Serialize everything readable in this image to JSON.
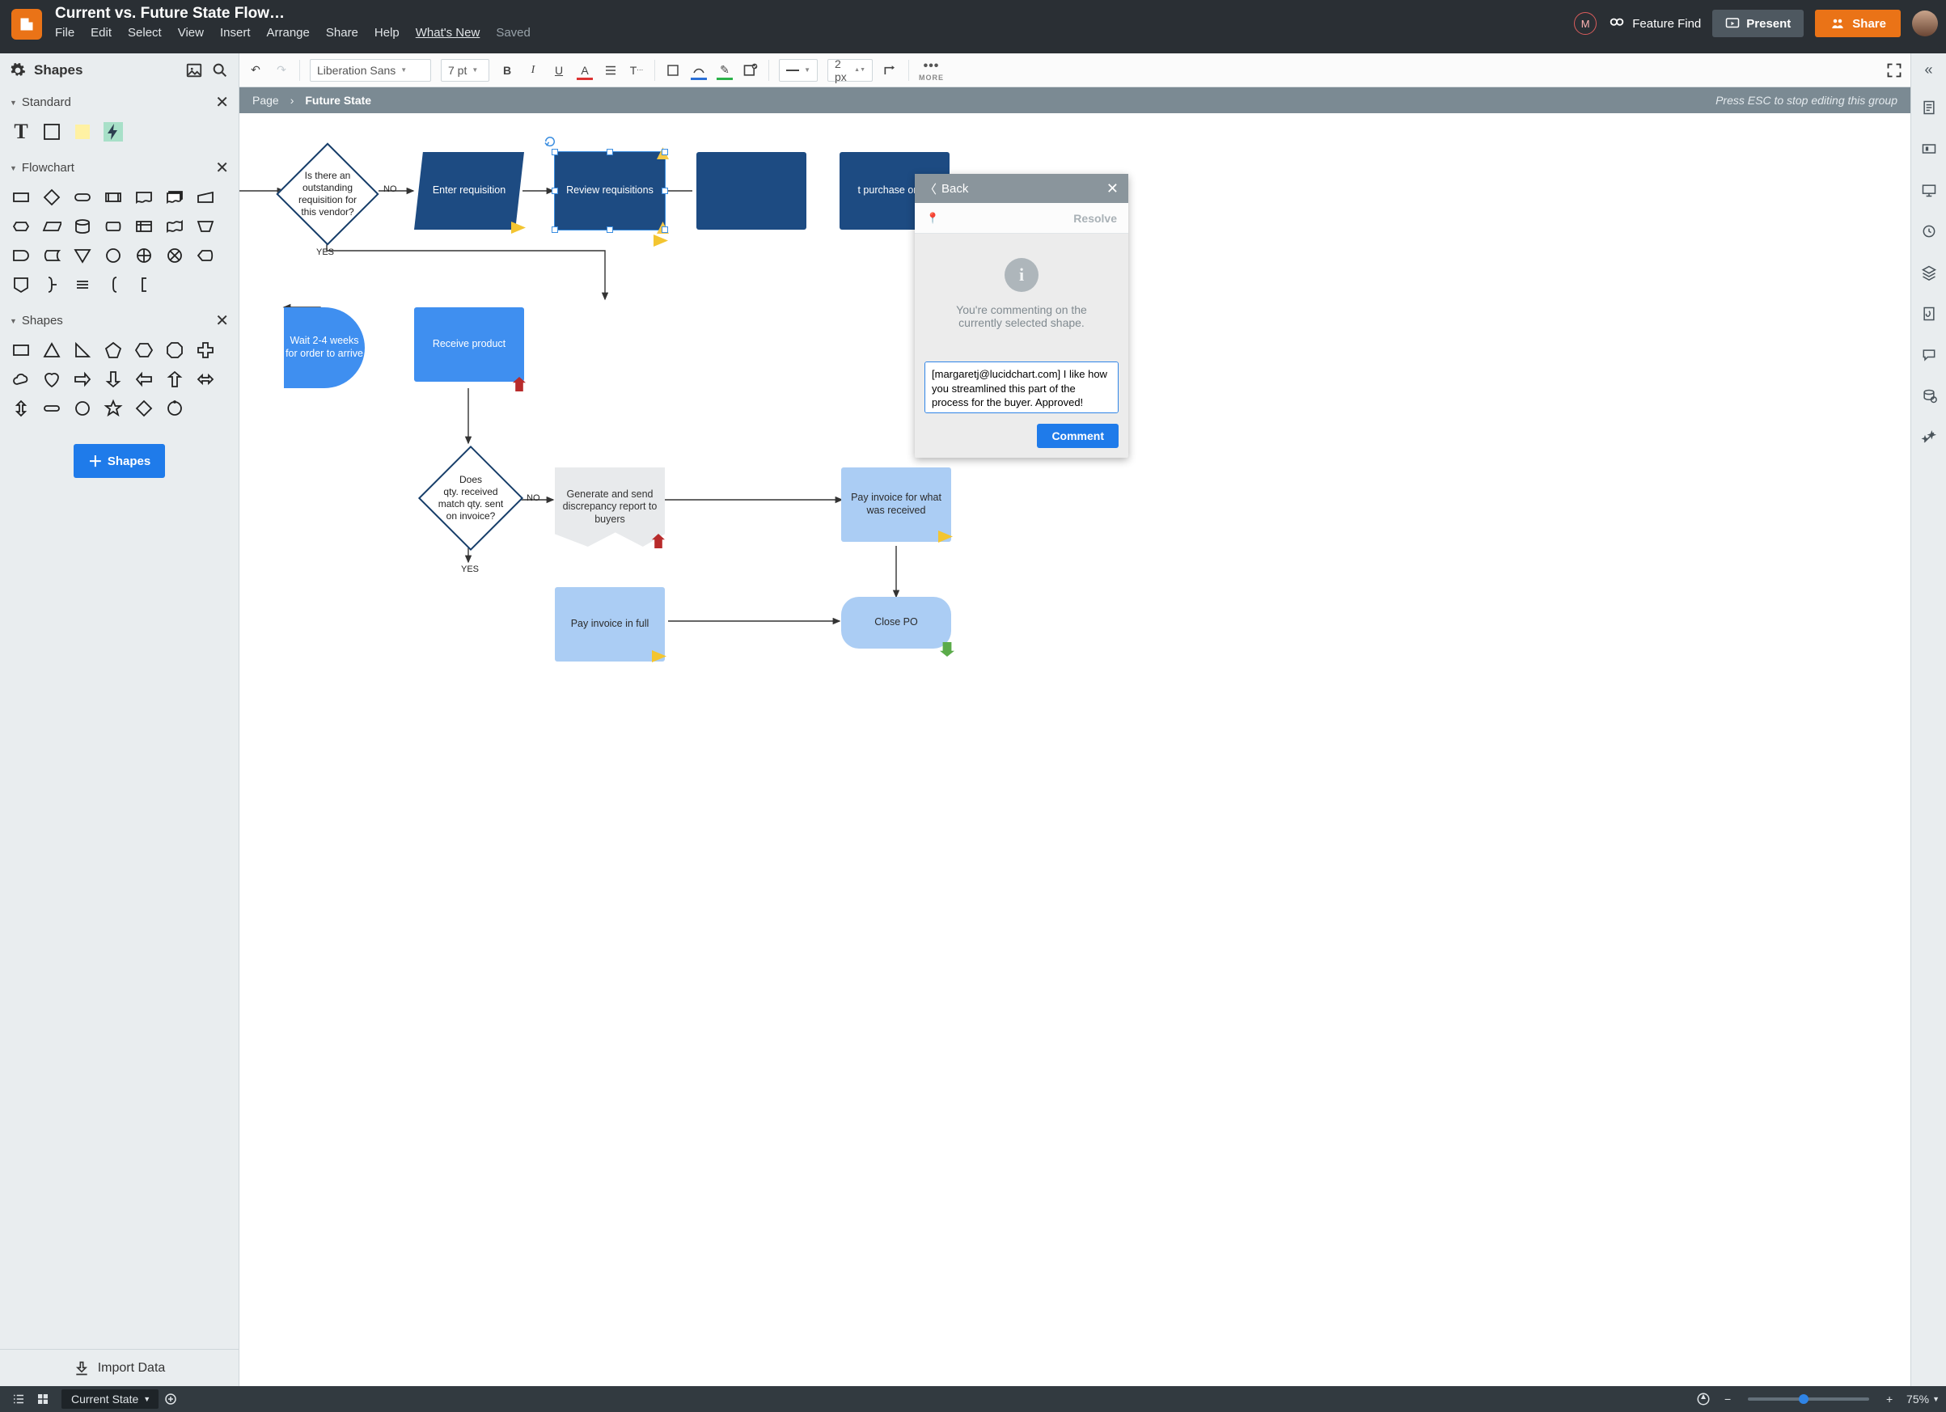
{
  "header": {
    "doc_title": "Current vs. Future State Flow…",
    "menu": {
      "file": "File",
      "edit": "Edit",
      "select": "Select",
      "view": "View",
      "insert": "Insert",
      "arrange": "Arrange",
      "share": "Share",
      "help": "Help",
      "whatsnew": "What's New",
      "saved": "Saved"
    },
    "feature_find": "Feature Find",
    "present": "Present",
    "share_btn": "Share",
    "avatar_initial": "M"
  },
  "left": {
    "shapes_label": "Shapes",
    "sections": {
      "standard": "Standard",
      "flowchart": "Flowchart",
      "shapes": "Shapes"
    },
    "add_shapes": "Shapes",
    "import": "Import Data"
  },
  "toolbar": {
    "font": "Liberation Sans",
    "size": "7 pt",
    "line_width": "2 px",
    "more": "MORE"
  },
  "crumb": {
    "page": "Page",
    "current": "Future State",
    "esc": "Press ESC to stop editing this group"
  },
  "nodes": {
    "decision1": "Is there an outstanding requisition for this vendor?",
    "decision1_yes": "YES",
    "decision1_no": "NO",
    "enter_req": "Enter requisition",
    "review_req": "Review requisitions",
    "purchase_order": "t purchase order",
    "wait": "Wait 2-4 weeks for order to arrive",
    "receive": "Receive product",
    "decision2": "Does\nqty. received match qty. sent on invoice?",
    "decision2_yes": "YES",
    "decision2_no": "NO",
    "discrepancy": "Generate and send discrepancy report to buyers",
    "pay_what": "Pay invoice for what was received",
    "pay_full": "Pay invoice in full",
    "close_po": "Close PO"
  },
  "comment": {
    "back": "Back",
    "resolve": "Resolve",
    "info": "You're commenting on the currently selected shape.",
    "text": "[margaretj@lucidchart.com] I like how you streamlined this part of the process for the buyer. Approved!",
    "button": "Comment"
  },
  "bottom": {
    "page_tab": "Current State",
    "zoom": "75%"
  }
}
